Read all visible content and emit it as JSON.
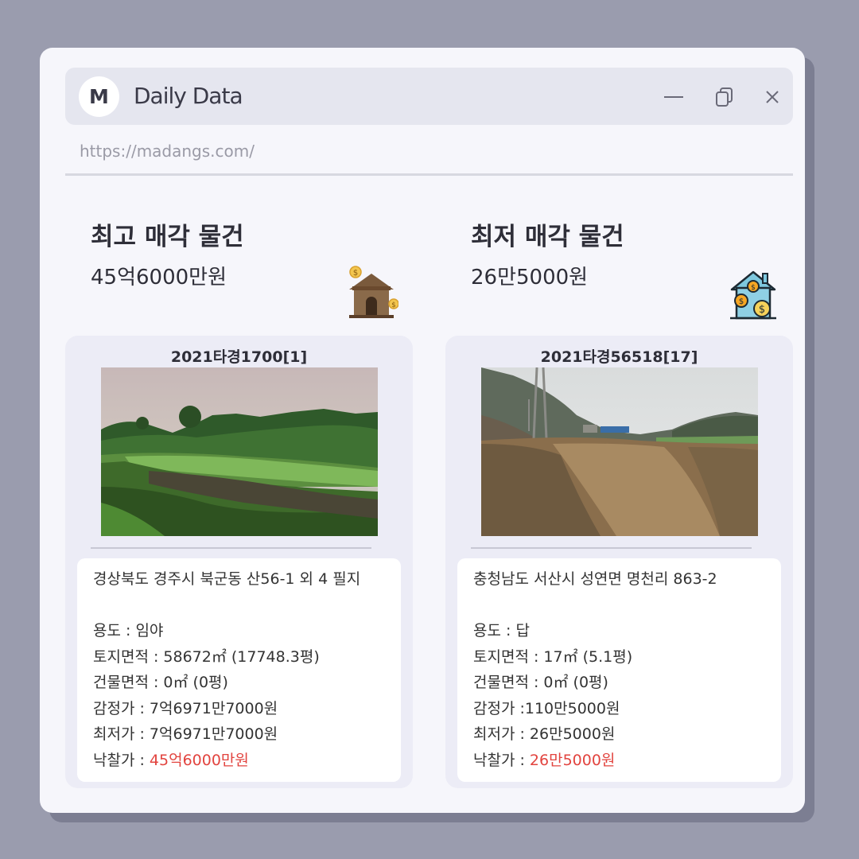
{
  "window": {
    "logo_letter": "M",
    "title": "Daily Data",
    "url": "https://madangs.com/"
  },
  "highest": {
    "heading": "최고 매각 물건",
    "price": "45억6000만원",
    "icon": "house-money-icon",
    "case_no": "2021타경1700[1]",
    "address": "경상북도 경주시 북군동 산56-1 외 4 필지",
    "use": "용도 : 임야",
    "land_area": "토지면적 : 58672㎡ (17748.3평)",
    "building_area": "건물면적 : 0㎡ (0평)",
    "appraisal": "감정가 : 7억6971만7000원",
    "minimum": "최저가 : 7억6971만7000원",
    "winning_label": "낙찰가 : ",
    "winning_value": "45억6000만원"
  },
  "lowest": {
    "heading": "최저 매각 물건",
    "price": "26만5000원",
    "icon": "house-coins-icon",
    "case_no": "2021타경56518[17]",
    "address": "충청남도 서산시 성연면 명천리 863-2",
    "use": "용도 : 답",
    "land_area": "토지면적 : 17㎡ (5.1평)",
    "building_area": "건물면적 : 0㎡ (0평)",
    "appraisal": "감정가 :110만5000원",
    "minimum": "최저가 : 26만5000원",
    "winning_label": "낙찰가 : ",
    "winning_value": "26만5000원"
  },
  "colors": {
    "background": "#9a9cae",
    "window": "#f6f6fb",
    "titlebar": "#e5e6ef",
    "card": "#ececf6",
    "winning_price": "#e2443f"
  }
}
